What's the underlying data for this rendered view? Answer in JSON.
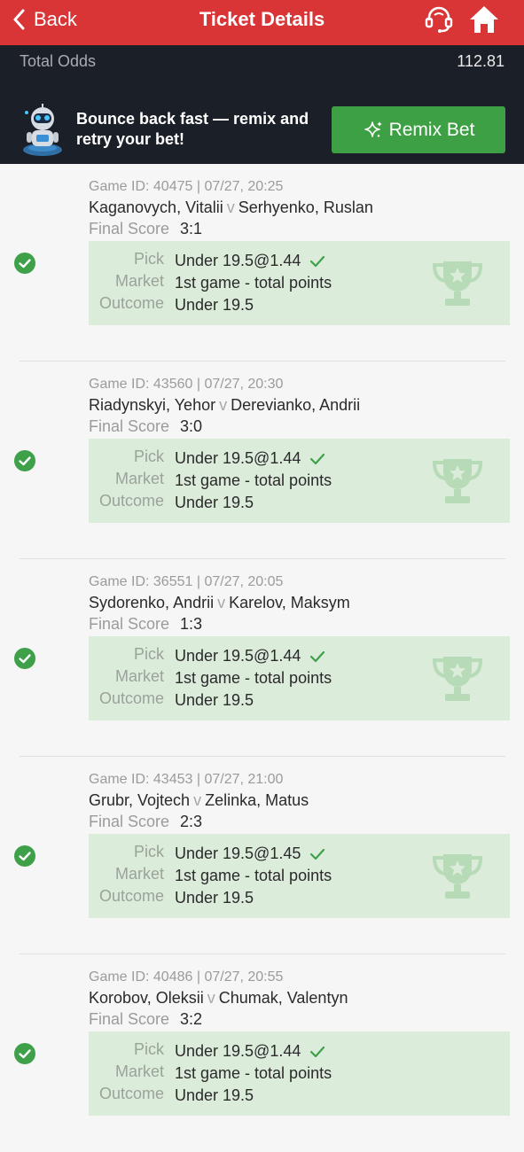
{
  "header": {
    "back_label": "Back",
    "title": "Ticket Details",
    "icons": [
      "support-headset-icon",
      "home-icon"
    ],
    "brand_color": "#d93537"
  },
  "summary": {
    "total_odds_label": "Total Odds",
    "total_odds_value": "112.81",
    "promo_text": "Bounce back fast — remix and retry your bet!",
    "remix_button_label": "Remix Bet",
    "remix_color": "#3ea045"
  },
  "labels": {
    "final_score": "Final Score",
    "pick": "Pick",
    "market": "Market",
    "outcome": "Outcome",
    "vs": "v"
  },
  "bets": [
    {
      "meta": "Game ID: 40475 | 07/27, 20:25",
      "player1": "Kaganovych, Vitalii",
      "player2": "Serhyenko, Ruslan",
      "score": "3:1",
      "pick": "Under 19.5@1.44",
      "market": "1st game - total points",
      "outcome": "Under 19.5",
      "status": "won"
    },
    {
      "meta": "Game ID: 43560 | 07/27, 20:30",
      "player1": "Riadynskyi, Yehor",
      "player2": "Derevianko, Andrii",
      "score": "3:0",
      "pick": "Under 19.5@1.44",
      "market": "1st game - total points",
      "outcome": "Under 19.5",
      "status": "won"
    },
    {
      "meta": "Game ID: 36551 | 07/27, 20:05",
      "player1": "Sydorenko, Andrii",
      "player2": "Karelov, Maksym",
      "score": "1:3",
      "pick": "Under 19.5@1.44",
      "market": "1st game - total points",
      "outcome": "Under 19.5",
      "status": "won"
    },
    {
      "meta": "Game ID: 43453 | 07/27, 21:00",
      "player1": "Grubr, Vojtech",
      "player2": "Zelinka, Matus",
      "score": "2:3",
      "pick": "Under 19.5@1.45",
      "market": "1st game - total points",
      "outcome": "Under 19.5",
      "status": "won"
    },
    {
      "meta": "Game ID: 40486 | 07/27, 20:55",
      "player1": "Korobov, Oleksii",
      "player2": "Chumak, Valentyn",
      "score": "3:2",
      "pick": "Under 19.5@1.44",
      "market": "1st game - total points",
      "outcome": "Under 19.5",
      "status": "won"
    }
  ]
}
